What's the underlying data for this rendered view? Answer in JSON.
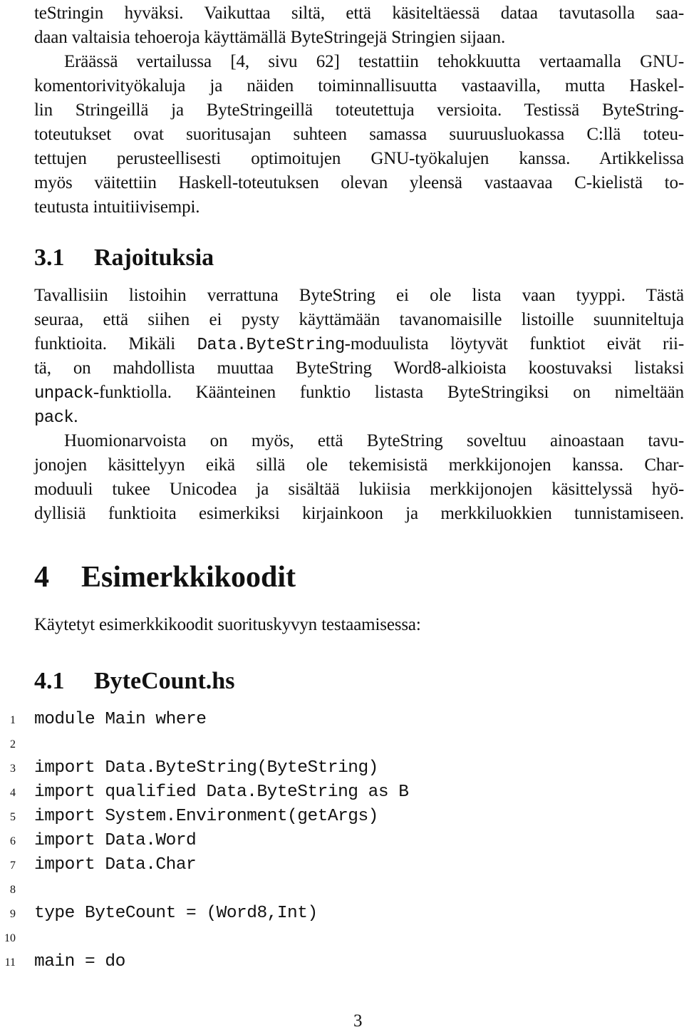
{
  "section3_intro": {
    "paragraph1_lines": [
      "teStringin hyväksi. Vaikuttaa siltä, että käsiteltäessä dataa tavutasolla saa-",
      "daan valtaisia tehoeroja käyttämällä ByteStringejä Stringien sijaan."
    ],
    "paragraph2_lines": [
      "Eräässä vertailussa [4, sivu 62] testattiin tehokkuutta vertaamalla GNU-",
      "komentorivityökaluja ja näiden toiminnallisuutta vastaavilla, mutta Haskel-",
      "lin Stringeillä ja ByteStringeillä toteutettuja versioita. Testissä ByteString-",
      "toteutukset ovat suoritusajan suhteen samassa suuruusluokassa C:llä toteu-",
      "tettujen perusteellisesti optimoitujen GNU-työkalujen kanssa. Artikkelissa",
      "myös väitettiin Haskell-toteutuksen olevan yleensä vastaavaa C-kielistä to-",
      "teutusta intuitiivisempi."
    ]
  },
  "section3_1": {
    "number": "3.1",
    "title": "Rajoituksia",
    "paragraph1": {
      "line1": "Tavallisiin listoihin verrattuna ByteString ei ole lista vaan tyyppi. Tästä",
      "line2": "seuraa, että siihen ei pysty käyttämään tavanomaisille listoille suunniteltuja",
      "line3_before": "funktioita. Mikäli ",
      "line3_code": "Data.ByteString",
      "line3_after": "-moduulista löytyvät funktiot eivät rii-",
      "line4": "tä, on mahdollista muuttaa ByteString Word8-alkioista koostuvaksi listaksi",
      "line5_code": "unpack",
      "line5_after": "-funktiolla. Käänteinen funktio listasta ByteStringiksi on nimeltään",
      "line6_code": "pack",
      "line6_after": "."
    },
    "paragraph2_lines": [
      "Huomionarvoista on myös, että ByteString soveltuu ainoastaan tavu-",
      "jonojen käsittelyyn eikä sillä ole tekemisistä merkkijonojen kanssa. Char-",
      "moduuli tukee Unicodea ja sisältää lukiisia merkkijonojen käsittelyssä hyö-",
      "dyllisiä funktioita esimerkiksi kirjainkoon ja merkkiluokkien tunnistamiseen."
    ]
  },
  "section4": {
    "number": "4",
    "title": "Esimerkkikoodit",
    "intro": "Käytetyt esimerkkikoodit suorituskyvyn testaamisessa:"
  },
  "section4_1": {
    "number": "4.1",
    "title": "ByteCount.hs",
    "code_lines": [
      {
        "n": "1",
        "text": "module Main where"
      },
      {
        "n": "2",
        "text": ""
      },
      {
        "n": "3",
        "text": "import Data.ByteString(ByteString)"
      },
      {
        "n": "4",
        "text": "import qualified Data.ByteString as B"
      },
      {
        "n": "5",
        "text": "import System.Environment(getArgs)"
      },
      {
        "n": "6",
        "text": "import Data.Word"
      },
      {
        "n": "7",
        "text": "import Data.Char"
      },
      {
        "n": "8",
        "text": ""
      },
      {
        "n": "9",
        "text": "type ByteCount = (Word8,Int)"
      },
      {
        "n": "10",
        "text": ""
      },
      {
        "n": "11",
        "text": "main = do"
      }
    ]
  },
  "footer": {
    "page_number": "3"
  }
}
